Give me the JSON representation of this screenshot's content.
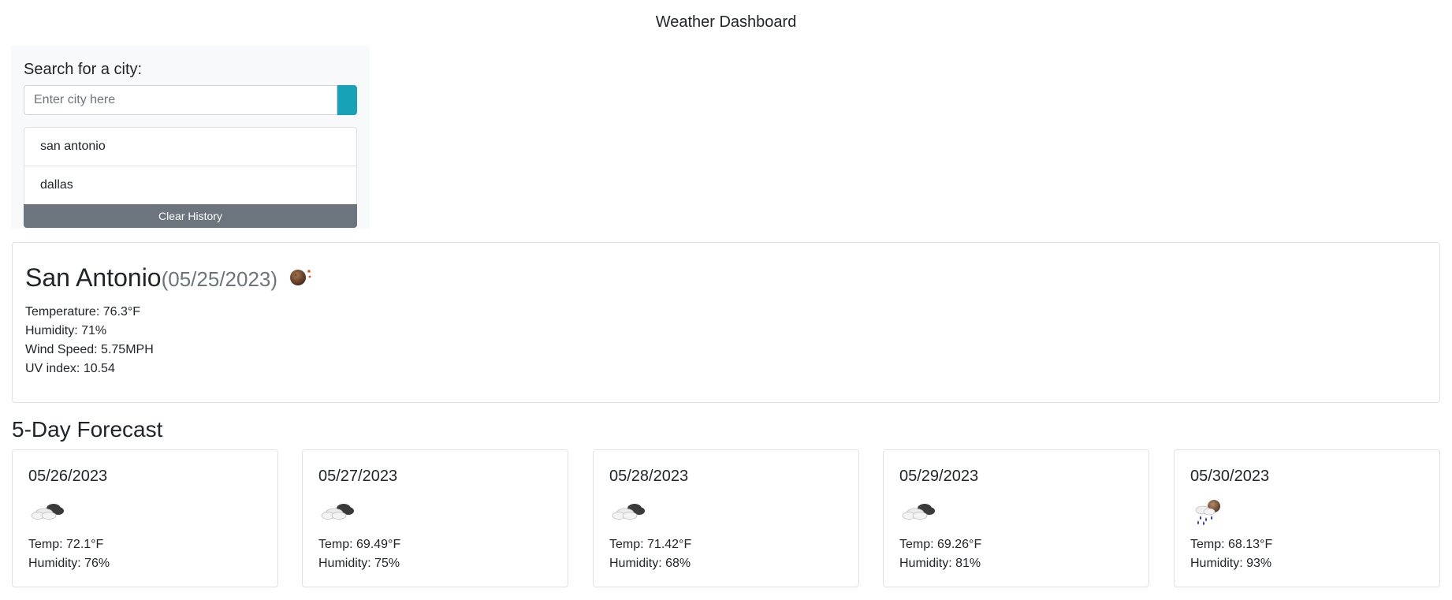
{
  "header": {
    "title": "Weather Dashboard"
  },
  "search": {
    "label": "Search for a city:",
    "placeholder": "Enter city here",
    "button_color": "#17a2b8"
  },
  "history": {
    "items": [
      {
        "label": "san antonio"
      },
      {
        "label": "dallas"
      }
    ],
    "clear_label": "Clear History"
  },
  "current": {
    "city": "San Antonio",
    "date": "(05/25/2023)",
    "icon": "clear-night-moon-icon",
    "temperature": "Temperature: 76.3°F",
    "humidity": "Humidity: 71%",
    "wind": "Wind Speed: 5.75MPH",
    "uv": "UV index: 10.54"
  },
  "forecast": {
    "title": "5-Day Forecast",
    "days": [
      {
        "date": "05/26/2023",
        "icon": "cloudy-icon",
        "temp": "Temp: 72.1°F",
        "humidity": "Humidity: 76%"
      },
      {
        "date": "05/27/2023",
        "icon": "cloudy-icon",
        "temp": "Temp: 69.49°F",
        "humidity": "Humidity: 75%"
      },
      {
        "date": "05/28/2023",
        "icon": "cloudy-icon",
        "temp": "Temp: 71.42°F",
        "humidity": "Humidity: 68%"
      },
      {
        "date": "05/29/2023",
        "icon": "cloudy-icon",
        "temp": "Temp: 69.26°F",
        "humidity": "Humidity: 81%"
      },
      {
        "date": "05/30/2023",
        "icon": "rain-night-icon",
        "temp": "Temp: 68.13°F",
        "humidity": "Humidity: 93%"
      }
    ]
  }
}
